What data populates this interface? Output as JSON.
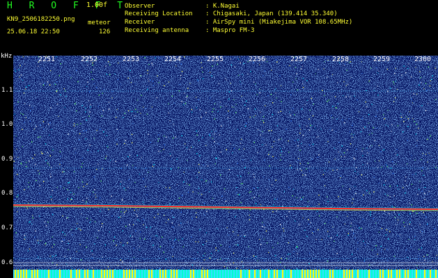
{
  "header": {
    "brand": "H R O F F T",
    "version": "1.00f",
    "filename": "KN9_2506182250.png",
    "meteor_label": "meteor",
    "datetime": "25.06.18 22:50",
    "meteor_count": "126"
  },
  "meta": [
    {
      "key": "Observer",
      "value": ": K.Nagai"
    },
    {
      "key": "Receiving Location",
      "value": ": Chigasaki, Japan (139.414 35.340)"
    },
    {
      "key": "Receiver",
      "value": ": AirSpy mini (Miakejima VOR 108.65MHz)"
    },
    {
      "key": "Receiving antenna",
      "value": ": Maspro FM-3"
    }
  ],
  "axis": {
    "y_unit": "kHz",
    "y_ticks": [
      "1.1",
      "1.0",
      "0.9",
      "0.8",
      "0.7",
      "0.6"
    ],
    "x_ticks": [
      "2251",
      "2252",
      "2253",
      "2254",
      "2255",
      "2256",
      "2257",
      "2258",
      "2259",
      "2300"
    ]
  },
  "colors": {
    "background": "#041260",
    "header_text": "#ffff33",
    "brand": "#22ff22",
    "carrier": "#ff2a2a"
  }
}
